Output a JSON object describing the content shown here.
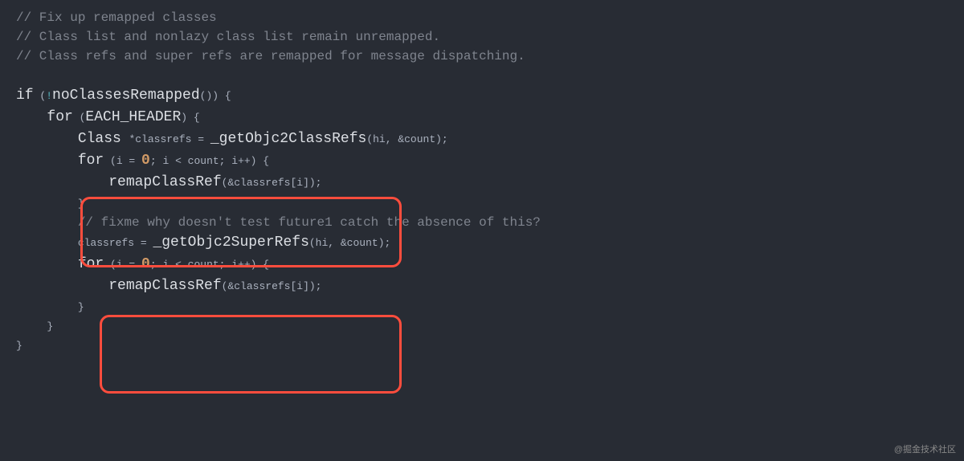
{
  "code": {
    "c1": "// Fix up remapped classes",
    "c2": "// Class list and nonlazy class list remain unremapped.",
    "c3": "// Class refs and super refs are remapped for message dispatching.",
    "kw_if": "if",
    "kw_for1": "for",
    "kw_for2": "for",
    "kw_for3": "for",
    "kw_for4": "for",
    "bang": "!",
    "fn_noClasses": "noClassesRemapped",
    "each_header": "EACH_HEADER",
    "type_class": "Class",
    "star": "*",
    "var_classrefs": "classrefs",
    "eq": " = ",
    "fn_getObjc2ClassRefs": "_getObjc2ClassRefs",
    "args_hi_count": "(hi, &count);",
    "i_eq": "i = ",
    "zero1": "0",
    "zero2": "0",
    "loop_tail": "; i < count; i++) {",
    "fn_remap1": "remapClassRef",
    "fn_remap2": "remapClassRef",
    "remap_args": "(&classrefs[i]);",
    "close_brace": "}",
    "c_fixme": "// fixme why doesn't test future1 catch the absence of this?",
    "classrefs_eq": "classrefs = ",
    "fn_getObjc2SuperRefs": "_getObjc2SuperRefs",
    "paren_open": "(",
    "paren_close": ")",
    "space_brace": " {",
    "paren_close_space_brace": ") {",
    "paren_close_paren_close_space_brace": "()) {"
  },
  "watermark": "@掘金技术社区"
}
